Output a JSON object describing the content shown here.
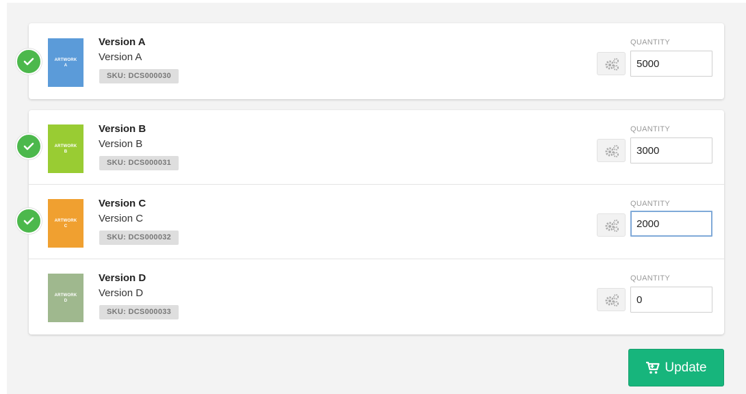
{
  "items": [
    {
      "title": "Version A",
      "subtitle": "Version A",
      "sku": "SKU: DCS000030",
      "thumb_line1": "ARTWORK",
      "thumb_line2": "A",
      "thumb_color": "#5b9bd9",
      "quantity_label": "QUANTITY",
      "quantity": "5000",
      "checked": true
    },
    {
      "title": "Version B",
      "subtitle": "Version B",
      "sku": "SKU: DCS000031",
      "thumb_line1": "ARTWORK",
      "thumb_line2": "B",
      "thumb_color": "#99cc33",
      "quantity_label": "QUANTITY",
      "quantity": "3000",
      "checked": true
    },
    {
      "title": "Version C",
      "subtitle": "Version C",
      "sku": "SKU: DCS000032",
      "thumb_line1": "ARTWORK",
      "thumb_line2": "C",
      "thumb_color": "#f0a030",
      "quantity_label": "QUANTITY",
      "quantity": "2000",
      "checked": true
    },
    {
      "title": "Version D",
      "subtitle": "Version D",
      "sku": "SKU: DCS000033",
      "thumb_line1": "ARTWORK",
      "thumb_line2": "D",
      "thumb_color": "#9fb88e",
      "quantity_label": "QUANTITY",
      "quantity": "0",
      "checked": false
    }
  ],
  "update_button": {
    "label": "Update",
    "icon": "cart-icon",
    "color": "#17b57c"
  },
  "colors": {
    "check": "#4cb84c",
    "focus_border": "#7fa9d8"
  }
}
